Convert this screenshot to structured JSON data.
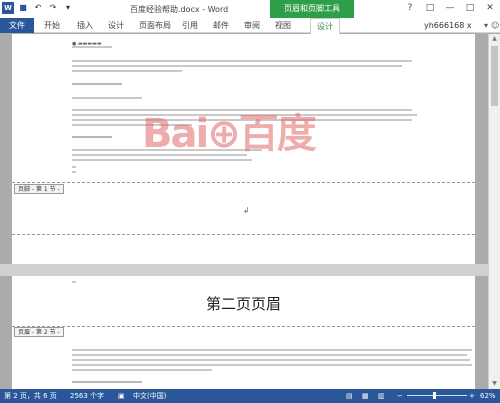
{
  "titlebar": {
    "title": "百度经验帮助.docx - Word",
    "context_group": "页眉和页脚工具",
    "app_badge": "W",
    "help": "?",
    "restore": "□",
    "minimize": "—",
    "maximize": "□",
    "close": "✕"
  },
  "ribbon": {
    "file": "文件",
    "tabs": [
      "开始",
      "插入",
      "设计",
      "页面布局",
      "引用",
      "邮件",
      "审阅",
      "视图"
    ],
    "context_tab": "设计",
    "user": "yh666168 x",
    "user_arrow": "▾",
    "smiley": "☺"
  },
  "page1": {
    "watermark": "Bai⊕百度",
    "footer_label": "页脚 - 第 1 节 -",
    "cursor_glyph": "↲"
  },
  "page2": {
    "header_label": "页眉 - 第 2 节 -",
    "header_text": "第二页页眉"
  },
  "statusbar": {
    "page": "第 2 页，共 6 页",
    "words": "2563 个字",
    "language": "中文(中国)",
    "zoom": "62%",
    "zoom_minus": "−",
    "zoom_plus": "+"
  },
  "scroll": {
    "up": "▲",
    "down": "▼"
  }
}
